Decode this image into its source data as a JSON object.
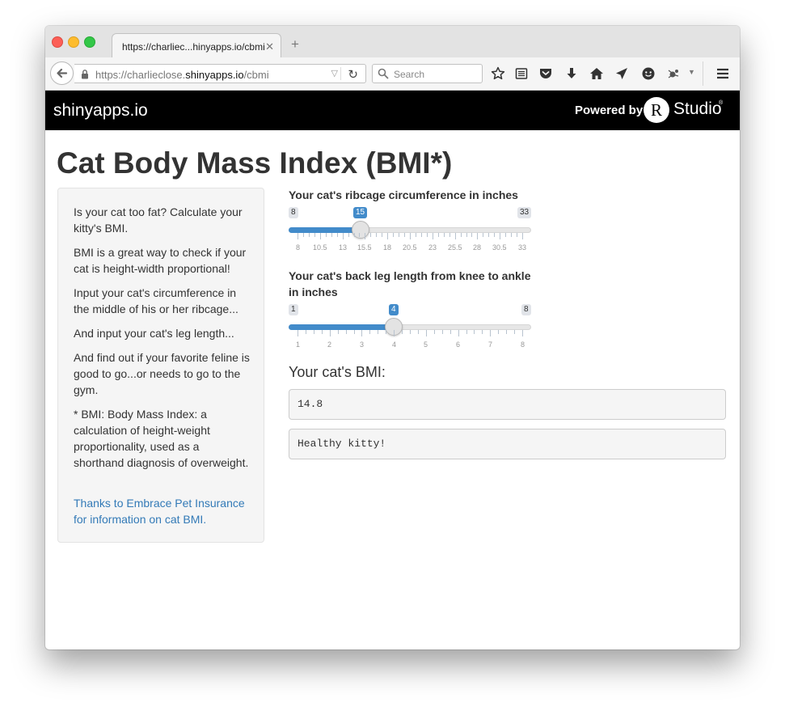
{
  "browser": {
    "tab_title": "https://charliec...hinyapps.io/cbmi",
    "url_prefix": "https://charlieclose.",
    "url_domain": "shinyapps.io",
    "url_path": "/cbmi",
    "search_placeholder": "Search"
  },
  "header": {
    "brand": "shinyapps.io",
    "powered_by": "Powered by",
    "r_letter": "R",
    "studio": "Studio",
    "trademark": "®"
  },
  "page": {
    "title": "Cat Body Mass Index (BMI*)"
  },
  "sidebar": {
    "paragraphs": [
      "Is your cat too fat? Calculate your kitty's BMI.",
      "BMI is a great way to check if your cat is height-width proportional!",
      "Input your cat's circumference in the middle of his or her ribcage...",
      "And input your cat's leg length...",
      "And find out if your favorite feline is good to go...or needs to go to the gym.",
      "* BMI: Body Mass Index: a calculation of height-weight proportionality, used as a shorthand diagnosis of overweight."
    ],
    "link": "Thanks to Embrace Pet Insurance for information on cat BMI."
  },
  "sliders": {
    "ribcage": {
      "label": "Your cat's ribcage circumference in inches",
      "min": 8,
      "max": 33,
      "value": 15,
      "min_label": "8",
      "max_label": "33",
      "value_label": "15",
      "tick_labels": [
        "8",
        "10.5",
        "13",
        "15.5",
        "18",
        "20.5",
        "23",
        "25.5",
        "28",
        "30.5",
        "33"
      ]
    },
    "leg": {
      "label": "Your cat's back leg length from knee to ankle in inches",
      "min": 1,
      "max": 8,
      "value": 4,
      "min_label": "1",
      "max_label": "8",
      "value_label": "4",
      "tick_labels": [
        "1",
        "2",
        "3",
        "4",
        "5",
        "6",
        "7",
        "8"
      ]
    }
  },
  "result": {
    "heading": "Your cat's BMI:",
    "bmi_value": "14.8",
    "verdict": "Healthy kitty!"
  },
  "colors": {
    "accent": "#428bca",
    "link": "#337ab7",
    "header_bg": "#000000"
  }
}
